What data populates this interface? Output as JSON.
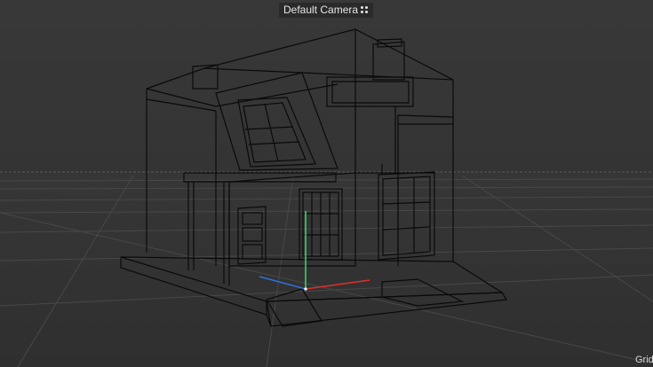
{
  "viewport": {
    "camera_name": "Default Camera",
    "camera_menu_icon": "camera-options-icon",
    "grid_label": "Grid",
    "colors": {
      "background": "#333333",
      "grid_line": "#4a4a4a",
      "horizon_line": "#5a5a5a",
      "wireframe": "#000000",
      "axis_x": "#d9302c",
      "axis_y": "#3ad16a",
      "axis_z": "#2f6fd9"
    }
  }
}
